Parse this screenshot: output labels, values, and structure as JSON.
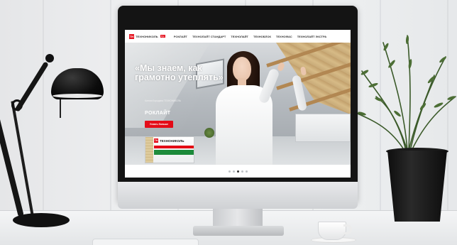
{
  "site": {
    "logo": {
      "mark": "ТН",
      "text": "ТЕХНОНИКОЛЬ",
      "sub": "Рус"
    },
    "nav": [
      {
        "label": "РОКЛАЙТ"
      },
      {
        "label": "ТЕХНОЛАЙТ СТАНДАРТ"
      },
      {
        "label": "ТЕХНОЛАЙТ"
      },
      {
        "label": "ТЕХНОБЛОК"
      },
      {
        "label": "ТЕХНОФАС"
      },
      {
        "label": "ТЕХНОЛАЙТ ЭКСТРА"
      }
    ],
    "hero": {
      "title": "«Мы знаем, как грамотно утеплять»",
      "author": "Ксения Бородина ТЕХНОНИКОЛЬ",
      "brand": "РОКЛАЙТ",
      "button_label": "Узнать больше"
    },
    "product": {
      "logo_mark": "ТН",
      "logo_text": "ТЕХНОНИКОЛЬ",
      "band_text": "МАСТЕР"
    },
    "slider": {
      "total": 5,
      "active": 2
    }
  },
  "colors": {
    "brand_red": "#e30613",
    "brand_green": "#1c8a3a"
  }
}
